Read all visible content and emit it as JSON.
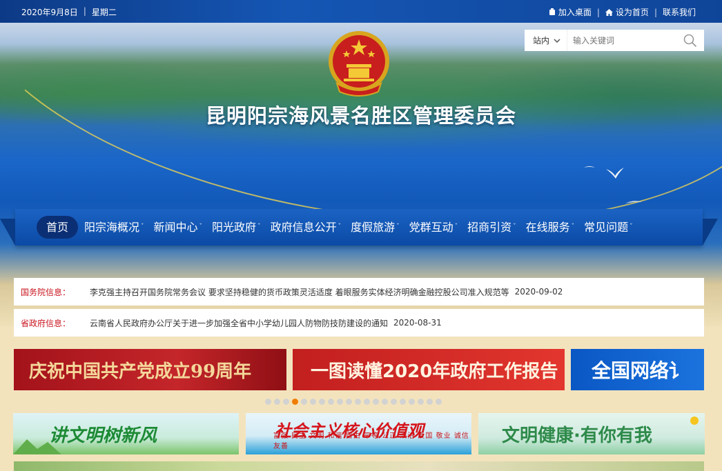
{
  "topbar": {
    "date": "2020年9月8日",
    "separator": "|",
    "weekday": "星期二",
    "links": [
      {
        "label": "加入桌面",
        "icon": "bookmark-icon"
      },
      {
        "label": "设为首页",
        "icon": "home-icon"
      },
      {
        "label": "联系我们",
        "icon": ""
      }
    ]
  },
  "header": {
    "title": "昆明阳宗海风景名胜区管理委员会",
    "emblem": "national-emblem"
  },
  "search": {
    "scope": "站内",
    "placeholder": "输入关键词",
    "icon": "search-icon"
  },
  "nav": {
    "items": [
      {
        "label": "首页",
        "dropdown": false,
        "active": true
      },
      {
        "label": "阳宗海概况",
        "dropdown": true
      },
      {
        "label": "新闻中心",
        "dropdown": true
      },
      {
        "label": "阳光政府",
        "dropdown": true
      },
      {
        "label": "政府信息公开",
        "dropdown": true
      },
      {
        "label": "度假旅游",
        "dropdown": true
      },
      {
        "label": "党群互动",
        "dropdown": true
      },
      {
        "label": "招商引资",
        "dropdown": true
      },
      {
        "label": "在线服务",
        "dropdown": true
      },
      {
        "label": "常见问题",
        "dropdown": true
      }
    ],
    "caret": "ˇ"
  },
  "notices": [
    {
      "label": "国务院信息：",
      "text": "李克强主持召开国务院常务会议 要求坚持稳健的货币政策灵活适度 着眼服务实体经济明确金融控股公司准入规范等",
      "date": "2020-09-02"
    },
    {
      "label": "省政府信息：",
      "text": "云南省人民政府办公厅关于进一步加强全省中小学幼儿园人防物防技防建设的通知",
      "date": "2020-08-31"
    }
  ],
  "banners": [
    {
      "text": "庆祝中国共产党成立99周年"
    },
    {
      "text": "一图读懂2020年政府工作报告"
    },
    {
      "text": "全国网络讠"
    }
  ],
  "carousel": {
    "count": 20,
    "active_index": 3
  },
  "tiles": [
    {
      "text": "讲文明树新风"
    },
    {
      "text": "社会主义核心价值观",
      "sub": "富强 民主 文明 和谐 自由 平等 公正 法治 爱国 敬业 诚信 友善"
    },
    {
      "text": "文明健康·有你有我"
    }
  ],
  "colors": {
    "nav_blue": "#1b63c4",
    "notice_label": "#c8141e",
    "active_dot": "#ef7d00"
  }
}
